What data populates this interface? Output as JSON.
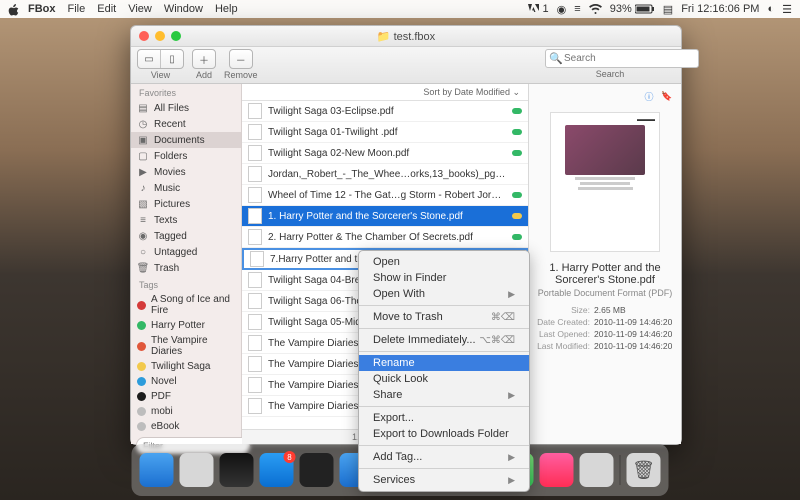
{
  "menubar": {
    "app": "FBox",
    "items": [
      "File",
      "Edit",
      "View",
      "Window",
      "Help"
    ],
    "status": {
      "adobe": "1",
      "battery": "93%",
      "clock": "Fri 12:16:06 PM"
    }
  },
  "window": {
    "title": "test.fbox",
    "toolbar": {
      "view": "View",
      "add": "Add",
      "remove": "Remove",
      "search_label": "Search",
      "search_placeholder": "Search"
    },
    "sidebar": {
      "favorites_head": "Favorites",
      "favorites": [
        {
          "icon": "all",
          "label": "All Files"
        },
        {
          "icon": "recent",
          "label": "Recent"
        },
        {
          "icon": "doc",
          "label": "Documents",
          "selected": true
        },
        {
          "icon": "folder",
          "label": "Folders"
        },
        {
          "icon": "movie",
          "label": "Movies"
        },
        {
          "icon": "music",
          "label": "Music"
        },
        {
          "icon": "pic",
          "label": "Pictures"
        },
        {
          "icon": "text",
          "label": "Texts"
        },
        {
          "icon": "tag",
          "label": "Tagged"
        },
        {
          "icon": "untag",
          "label": "Untagged"
        },
        {
          "icon": "trash",
          "label": "Trash"
        }
      ],
      "tags_head": "Tags",
      "tags": [
        {
          "color": "#d43a3a",
          "label": "A Song of Ice and Fire"
        },
        {
          "color": "#33b866",
          "label": "Harry Potter"
        },
        {
          "color": "#e0573b",
          "label": "The Vampire Diaries"
        },
        {
          "color": "#f2c94c",
          "label": "Twilight Saga"
        },
        {
          "color": "#2d9cdb",
          "label": "Novel"
        },
        {
          "color": "#1c1c1c",
          "label": "PDF"
        },
        {
          "color": "#bdbdbd",
          "label": "mobi"
        },
        {
          "color": "#bdbdbd",
          "label": "eBook"
        }
      ],
      "filter_placeholder": "Filter"
    },
    "sort_label": "Sort by Date Modified ⌄",
    "files": [
      {
        "name": "Twilight Saga 03-Eclipse.pdf",
        "status": "#33b866"
      },
      {
        "name": "Twilight Saga 01-Twilight .pdf",
        "status": "#33b866"
      },
      {
        "name": "Twilight Saga 02-New Moon.pdf",
        "status": "#33b866"
      },
      {
        "name": "Jordan,_Robert_-_The_Whee…orks,13_books)_pg_3931.pdf",
        "status": ""
      },
      {
        "name": "Wheel of Time 12 - The Gat…g Storm - Robert Jordan.pdf",
        "status": "#33b866"
      },
      {
        "name": "1. Harry Potter and the Sorcerer's Stone.pdf",
        "status": "#f2c94c",
        "selected": true
      },
      {
        "name": "2. Harry Potter & The Chamber Of Secrets.pdf",
        "status": "#33b866"
      },
      {
        "name": "7.Harry Potter and the De",
        "status": "",
        "editing": true
      },
      {
        "name": "Twilight Saga 04-Breaking",
        "status": ""
      },
      {
        "name": "Twilight Saga 06-The Sho",
        "status": ""
      },
      {
        "name": "Twilight Saga 05-Midnigh",
        "status": ""
      },
      {
        "name": "The Vampire Diaries 01 -",
        "status": ""
      },
      {
        "name": "The Vampire Diaries 02 -",
        "status": ""
      },
      {
        "name": "The Vampire Diaries 03 -",
        "status": ""
      },
      {
        "name": "The Vampire Diaries 04 -",
        "status": ""
      }
    ],
    "statusbar": "1. Harry Potter a",
    "details": {
      "title": "1. Harry Potter and the Sorcerer's Stone.pdf",
      "kind": "Portable Document Format (PDF)",
      "size_k": "Size:",
      "size_v": "2.65 MB",
      "created_k": "Date Created:",
      "created_v": "2010-11-09 14:46:20",
      "opened_k": "Last Opened:",
      "opened_v": "2010-11-09 14:46:20",
      "modified_k": "Last Modified:",
      "modified_v": "2010-11-09 14:46:20"
    }
  },
  "context_menu": {
    "items": [
      {
        "label": "Open"
      },
      {
        "label": "Show in Finder"
      },
      {
        "label": "Open With",
        "sub": true
      },
      {
        "sep": true
      },
      {
        "label": "Move to Trash",
        "shortcut": "⌘⌫"
      },
      {
        "sep": true
      },
      {
        "label": "Delete Immediately...",
        "shortcut": "⌥⌘⌫"
      },
      {
        "sep": true
      },
      {
        "label": "Rename",
        "hl": true
      },
      {
        "label": "Quick Look"
      },
      {
        "label": "Share",
        "sub": true
      },
      {
        "sep": true
      },
      {
        "label": "Export..."
      },
      {
        "label": "Export to Downloads Folder"
      },
      {
        "sep": true
      },
      {
        "label": "Add Tag...",
        "sub": true
      },
      {
        "sep": true
      },
      {
        "label": "Services",
        "sub": true
      }
    ]
  },
  "dock": {
    "apps": [
      {
        "name": "finder",
        "bg": "linear-gradient(#4aa3f0,#1b6fd0)"
      },
      {
        "name": "launchpad",
        "bg": "#d7d7d7"
      },
      {
        "name": "siri",
        "bg": "linear-gradient(#111,#333)"
      },
      {
        "name": "appstore",
        "bg": "linear-gradient(#2a9df4,#0a6ed1)",
        "badge": "8"
      },
      {
        "name": "terminal",
        "bg": "#222"
      },
      {
        "name": "mail",
        "bg": "linear-gradient(#4aa3f0,#1b6fd0)"
      },
      {
        "name": "notes",
        "bg": "linear-gradient(#ffe27a,#f6c855)"
      },
      {
        "name": "safari",
        "bg": "linear-gradient(#f0f0f0,#c9c9c9)"
      },
      {
        "name": "textedit",
        "bg": "#efefef"
      },
      {
        "name": "messages",
        "bg": "linear-gradient(#7ee07a,#34c759)"
      },
      {
        "name": "itunes",
        "bg": "linear-gradient(#ff5ea0,#ff2d55)"
      },
      {
        "name": "settings",
        "bg": "#d7d7d7"
      }
    ],
    "trash": {
      "name": "trash",
      "bg": "#d7d7d7"
    }
  }
}
